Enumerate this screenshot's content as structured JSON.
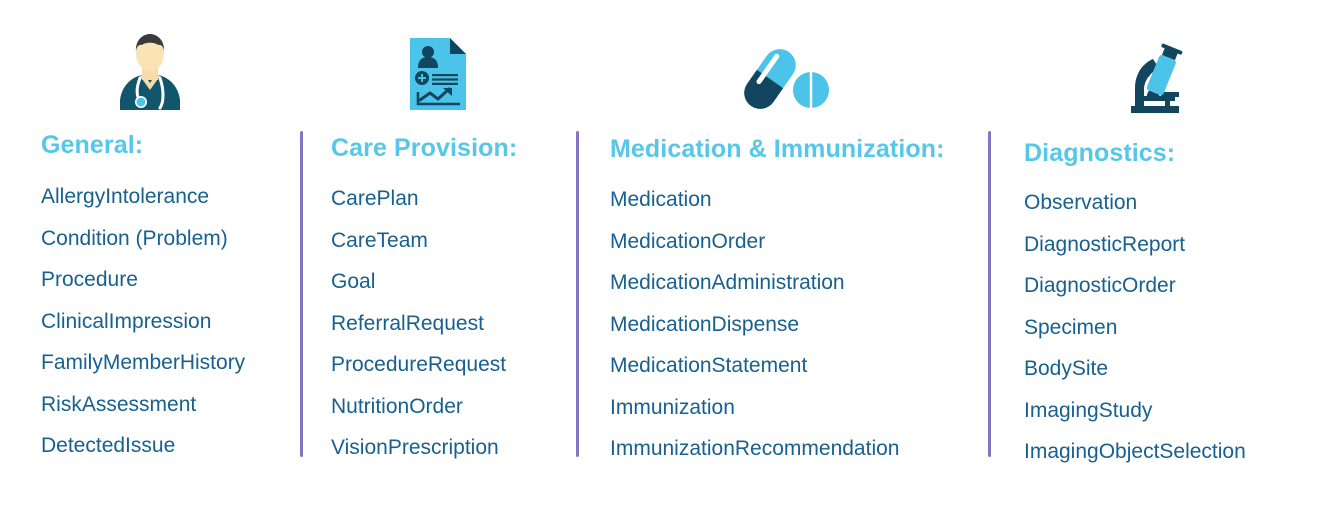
{
  "palette": {
    "background": "#ffffff",
    "heading": "#55c7e8",
    "item_text": "#17608f",
    "divider": "#8874c4",
    "icon_light_blue": "#4cc3e8",
    "icon_dark_navy": "#12465f",
    "icon_skin": "#fbdfb0",
    "icon_hair": "#3b3b3b"
  },
  "columns": [
    {
      "id": "general",
      "icon": "doctor-icon",
      "heading": "General:",
      "items": [
        "AllergyIntolerance",
        "Condition (Problem)",
        "Procedure",
        "ClinicalImpression",
        "FamilyMemberHistory",
        "RiskAssessment",
        "DetectedIssue"
      ]
    },
    {
      "id": "care-provision",
      "icon": "medical-record-document-icon",
      "heading": "Care Provision:",
      "items": [
        "CarePlan",
        "CareTeam",
        "Goal",
        "ReferralRequest",
        "ProcedureRequest",
        "NutritionOrder",
        "VisionPrescription"
      ]
    },
    {
      "id": "medication-immunization",
      "icon": "pills-icon",
      "heading": "Medication & Immunization:",
      "items": [
        "Medication",
        "MedicationOrder",
        "MedicationAdministration",
        "MedicationDispense",
        "MedicationStatement",
        "Immunization",
        "ImmunizationRecommendation"
      ]
    },
    {
      "id": "diagnostics",
      "icon": "microscope-icon",
      "heading": "Diagnostics:",
      "items": [
        "Observation",
        "DiagnosticReport",
        "DiagnosticOrder",
        "Specimen",
        "BodySite",
        "ImagingStudy",
        "ImagingObjectSelection"
      ]
    }
  ]
}
